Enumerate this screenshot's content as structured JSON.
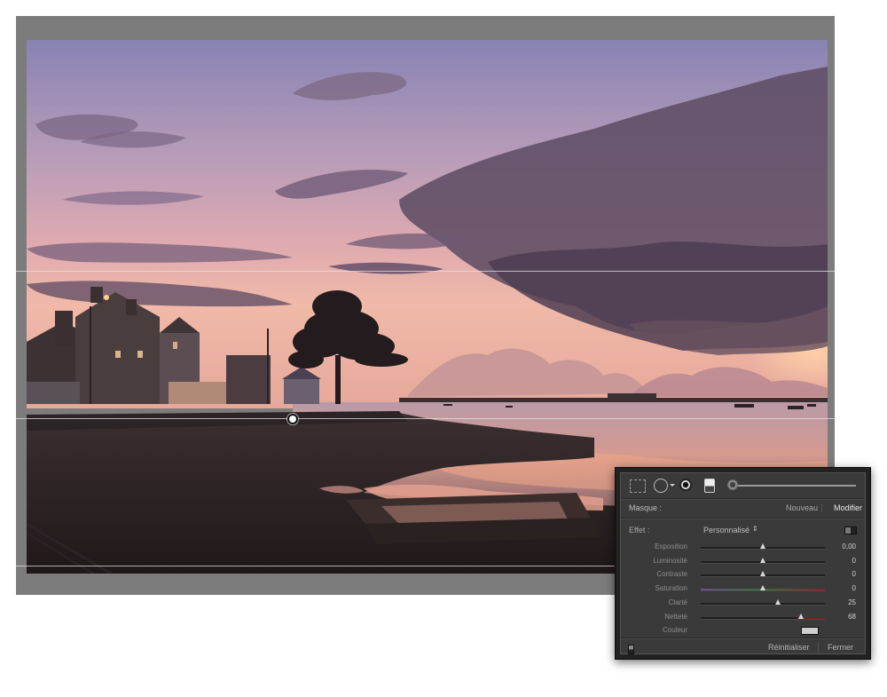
{
  "photo": {
    "subject": "sunset harbor landscape"
  },
  "panel": {
    "tools": [
      {
        "icon": "marquee-icon"
      },
      {
        "icon": "circle-mask-icon"
      },
      {
        "icon": "radial-filter-icon"
      },
      {
        "icon": "brush-icon"
      }
    ],
    "amount_level": 0.02,
    "masque_label": "Masque :",
    "nouveau_label": "Nouveau",
    "modifier_label": "Modifier",
    "effet_label": "Effet :",
    "effet_value": "Personnalisé",
    "effet_select_icon": "⇕",
    "sliders": [
      {
        "label": "Exposition",
        "value": "0,00",
        "level": 0.5
      },
      {
        "label": "Luminosité",
        "value": "0",
        "level": 0.5
      },
      {
        "label": "Contraste",
        "value": "0",
        "level": 0.5
      },
      {
        "label": "Saturation",
        "value": "0",
        "level": 0.5
      },
      {
        "label": "Clarté",
        "value": "25",
        "level": 0.62
      },
      {
        "label": "Netteté",
        "value": "68",
        "level": 0.81
      }
    ],
    "couleur_label": "Couleur",
    "couleur_swatch": "#cfcfcf",
    "reinitialiser_label": "Réinitialiser",
    "fermer_label": "Fermer"
  },
  "colors": {
    "panel_bg": "#3a3a3a",
    "canvas_bg": "#7c7c7c",
    "sky_top": "#8c86b4",
    "sky_horizon": "#eab2a3"
  }
}
